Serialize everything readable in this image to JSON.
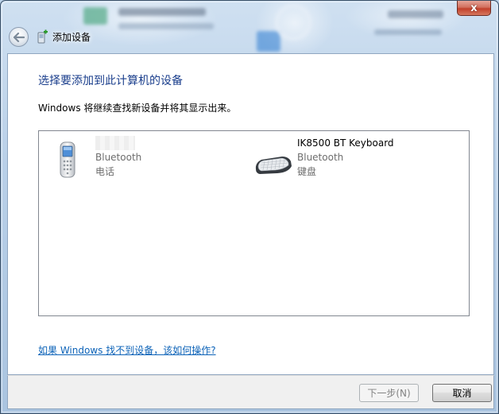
{
  "window": {
    "title": "添加设备",
    "close_label": "x"
  },
  "main": {
    "heading": "选择要添加到此计算机的设备",
    "subtext": "Windows 将继续查找新设备并将其显示出来。",
    "help_link": "如果 Windows 找不到设备，该如何操作?"
  },
  "devices": [
    {
      "name": "",
      "protocol": "Bluetooth",
      "category": "电话",
      "icon": "mobile-phone-icon"
    },
    {
      "name": "IK8500 BT Keyboard",
      "protocol": "Bluetooth",
      "category": "键盘",
      "icon": "keyboard-icon"
    }
  ],
  "footer": {
    "next_label": "下一步(N)",
    "cancel_label": "取消"
  },
  "colors": {
    "heading": "#1a3e8c",
    "link": "#0d63b8",
    "close_button": "#c2402b"
  }
}
